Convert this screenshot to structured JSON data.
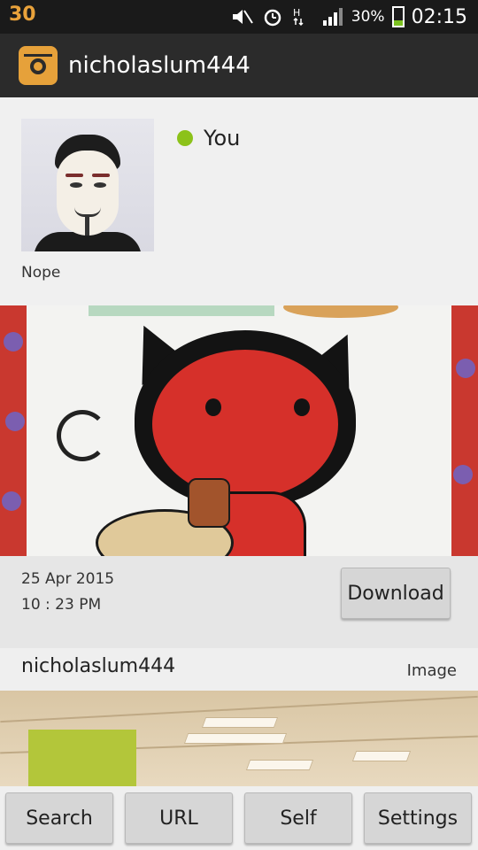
{
  "status_bar": {
    "notification_number": "30",
    "battery_percent": "30%",
    "time": "02:15",
    "icons": [
      "mute-icon",
      "alarm-icon",
      "hspa-data-icon",
      "signal-icon",
      "battery-icon"
    ]
  },
  "action_bar": {
    "title": "nicholaslum444",
    "logo_icon": "camera-app-icon"
  },
  "profile": {
    "status_label": "You",
    "status_color": "#8cc21a",
    "bio": "Nope"
  },
  "post": {
    "date": "25 Apr 2015",
    "time": "10 : 23 PM",
    "download_label": "Download"
  },
  "next_post": {
    "username": "nicholaslum444",
    "type": "Image"
  },
  "bottom_nav": {
    "search_label": "Search",
    "url_label": "URL",
    "self_label": "Self",
    "settings_label": "Settings"
  }
}
